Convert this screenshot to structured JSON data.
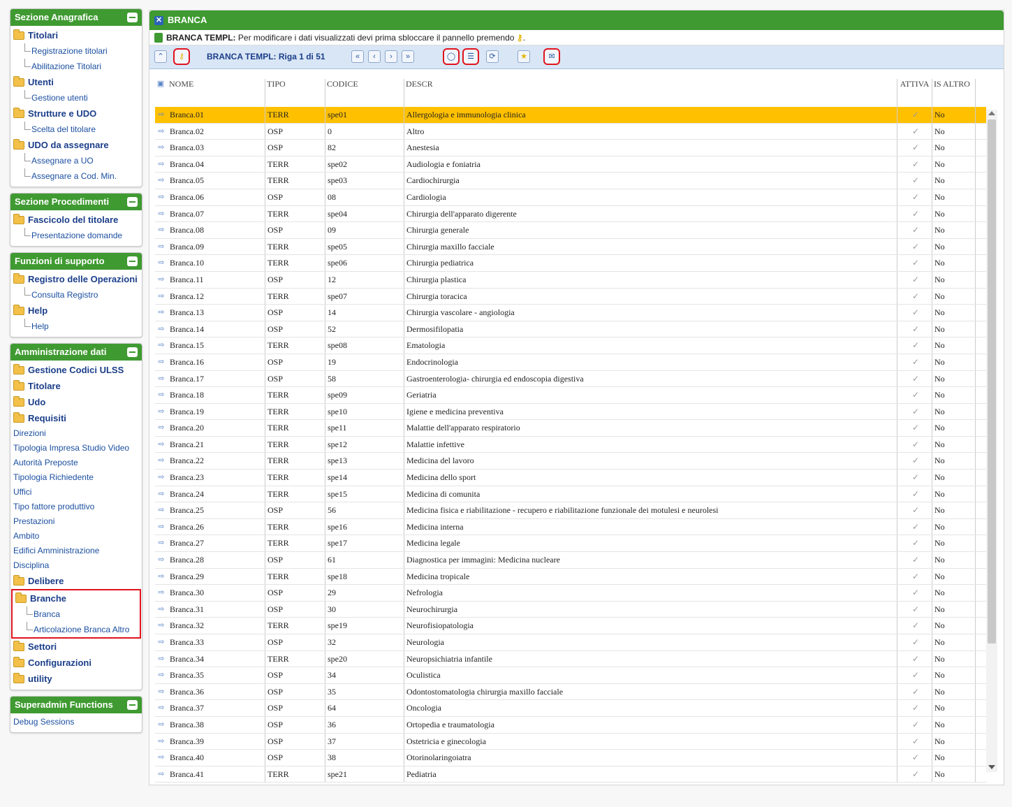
{
  "sidebar": {
    "anagrafica": {
      "title": "Sezione Anagrafica",
      "folders": [
        {
          "label": "Titolari",
          "leaves": [
            "Registrazione titolari",
            "Abilitazione Titolari"
          ]
        },
        {
          "label": "Utenti",
          "leaves": [
            "Gestione utenti"
          ]
        },
        {
          "label": "Strutture e UDO",
          "leaves": [
            "Scelta del titolare"
          ]
        },
        {
          "label": "UDO da assegnare",
          "leaves": [
            "Assegnare a UO",
            "Assegnare a Cod. Min."
          ]
        }
      ]
    },
    "procedimenti": {
      "title": "Sezione Procedimenti",
      "folders": [
        {
          "label": "Fascicolo del titolare",
          "leaves": [
            "Presentazione domande"
          ]
        }
      ]
    },
    "supporto": {
      "title": "Funzioni di supporto",
      "folders": [
        {
          "label": "Registro delle Operazioni",
          "leaves": [
            "Consulta Registro"
          ]
        },
        {
          "label": "Help",
          "leaves": [
            "Help"
          ]
        }
      ]
    },
    "admin": {
      "title": "Amministrazione dati",
      "f1": "Gestione Codici ULSS",
      "f2": "Titolare",
      "f3": "Udo",
      "f4": "Requisiti",
      "items": [
        "Direzioni",
        "Tipologia Impresa Studio Video",
        "Autorità Preposte",
        "Tipologia Richiedente",
        "Uffici",
        "Tipo fattore produttivo",
        "Prestazioni",
        "Ambito",
        "Edifici Amministrazione",
        "Disciplina"
      ],
      "f5": "Delibere",
      "branche": {
        "label": "Branche",
        "leaves": [
          "Branca",
          "Articolazione Branca Altro"
        ]
      },
      "f6": "Settori",
      "f7": "Configurazioni",
      "f8": "utility"
    },
    "superadmin": {
      "title": "Superadmin Functions",
      "items": [
        "Debug Sessions"
      ]
    }
  },
  "main": {
    "title": "BRANCA",
    "notice_bold": "BRANCA TEMPL:",
    "notice_text": "Per modificare i dati visualizzati devi prima sbloccare il pannello premendo",
    "notice_end": ".",
    "row_info": "BRANCA TEMPL: Riga 1 di 51",
    "nav": {
      "first": "«",
      "prev": "‹",
      "next": "›",
      "last": "»"
    }
  },
  "table": {
    "headers": [
      "NOME",
      "TIPO",
      "CODICE",
      "DESCR",
      "ATTIVA",
      "IS ALTRO"
    ],
    "rows": [
      [
        "Branca.01",
        "TERR",
        "spe01",
        "Allergologia e immunologia clinica",
        "No"
      ],
      [
        "Branca.02",
        "OSP",
        "0",
        "Altro",
        "No"
      ],
      [
        "Branca.03",
        "OSP",
        "82",
        "Anestesia",
        "No"
      ],
      [
        "Branca.04",
        "TERR",
        "spe02",
        "Audiologia e foniatria",
        "No"
      ],
      [
        "Branca.05",
        "TERR",
        "spe03",
        "Cardiochirurgia",
        "No"
      ],
      [
        "Branca.06",
        "OSP",
        "08",
        "Cardiologia",
        "No"
      ],
      [
        "Branca.07",
        "TERR",
        "spe04",
        "Chirurgia dell'apparato digerente",
        "No"
      ],
      [
        "Branca.08",
        "OSP",
        "09",
        "Chirurgia generale",
        "No"
      ],
      [
        "Branca.09",
        "TERR",
        "spe05",
        "Chirurgia maxillo facciale",
        "No"
      ],
      [
        "Branca.10",
        "TERR",
        "spe06",
        "Chirurgia pediatrica",
        "No"
      ],
      [
        "Branca.11",
        "OSP",
        "12",
        "Chirurgia plastica",
        "No"
      ],
      [
        "Branca.12",
        "TERR",
        "spe07",
        "Chirurgia toracica",
        "No"
      ],
      [
        "Branca.13",
        "OSP",
        "14",
        "Chirurgia vascolare - angiologia",
        "No"
      ],
      [
        "Branca.14",
        "OSP",
        "52",
        "Dermosifilopatia",
        "No"
      ],
      [
        "Branca.15",
        "TERR",
        "spe08",
        "Ematologia",
        "No"
      ],
      [
        "Branca.16",
        "OSP",
        "19",
        "Endocrinologia",
        "No"
      ],
      [
        "Branca.17",
        "OSP",
        "58",
        "Gastroenterologia- chirurgia ed endoscopia digestiva",
        "No"
      ],
      [
        "Branca.18",
        "TERR",
        "spe09",
        "Geriatria",
        "No"
      ],
      [
        "Branca.19",
        "TERR",
        "spe10",
        "Igiene e medicina preventiva",
        "No"
      ],
      [
        "Branca.20",
        "TERR",
        "spe11",
        "Malattie dell'apparato respiratorio",
        "No"
      ],
      [
        "Branca.21",
        "TERR",
        "spe12",
        "Malattie infettive",
        "No"
      ],
      [
        "Branca.22",
        "TERR",
        "spe13",
        "Medicina del lavoro",
        "No"
      ],
      [
        "Branca.23",
        "TERR",
        "spe14",
        "Medicina dello sport",
        "No"
      ],
      [
        "Branca.24",
        "TERR",
        "spe15",
        "Medicina di comunita",
        "No"
      ],
      [
        "Branca.25",
        "OSP",
        "56",
        "Medicina fisica e riabilitazione - recupero e riabilitazione funzionale dei motulesi e neurolesi",
        "No"
      ],
      [
        "Branca.26",
        "TERR",
        "spe16",
        "Medicina interna",
        "No"
      ],
      [
        "Branca.27",
        "TERR",
        "spe17",
        "Medicina legale",
        "No"
      ],
      [
        "Branca.28",
        "OSP",
        "61",
        "Diagnostica per immagini: Medicina nucleare",
        "No"
      ],
      [
        "Branca.29",
        "TERR",
        "spe18",
        "Medicina tropicale",
        "No"
      ],
      [
        "Branca.30",
        "OSP",
        "29",
        "Nefrologia",
        "No"
      ],
      [
        "Branca.31",
        "OSP",
        "30",
        "Neurochirurgia",
        "No"
      ],
      [
        "Branca.32",
        "TERR",
        "spe19",
        "Neurofisiopatologia",
        "No"
      ],
      [
        "Branca.33",
        "OSP",
        "32",
        "Neurologia",
        "No"
      ],
      [
        "Branca.34",
        "TERR",
        "spe20",
        "Neuropsichiatria infantile",
        "No"
      ],
      [
        "Branca.35",
        "OSP",
        "34",
        "Oculistica",
        "No"
      ],
      [
        "Branca.36",
        "OSP",
        "35",
        "Odontostomatologia chirurgia maxillo facciale",
        "No"
      ],
      [
        "Branca.37",
        "OSP",
        "64",
        "Oncologia",
        "No"
      ],
      [
        "Branca.38",
        "OSP",
        "36",
        "Ortopedia e traumatologia",
        "No"
      ],
      [
        "Branca.39",
        "OSP",
        "37",
        "Ostetricia e ginecologia",
        "No"
      ],
      [
        "Branca.40",
        "OSP",
        "38",
        "Otorinolaringoiatra",
        "No"
      ],
      [
        "Branca.41",
        "TERR",
        "spe21",
        "Pediatria",
        "No"
      ]
    ]
  },
  "colors": {
    "accent_green": "#3f9a31",
    "selected_row": "#ffc000",
    "highlight_red": "#e0141e"
  }
}
